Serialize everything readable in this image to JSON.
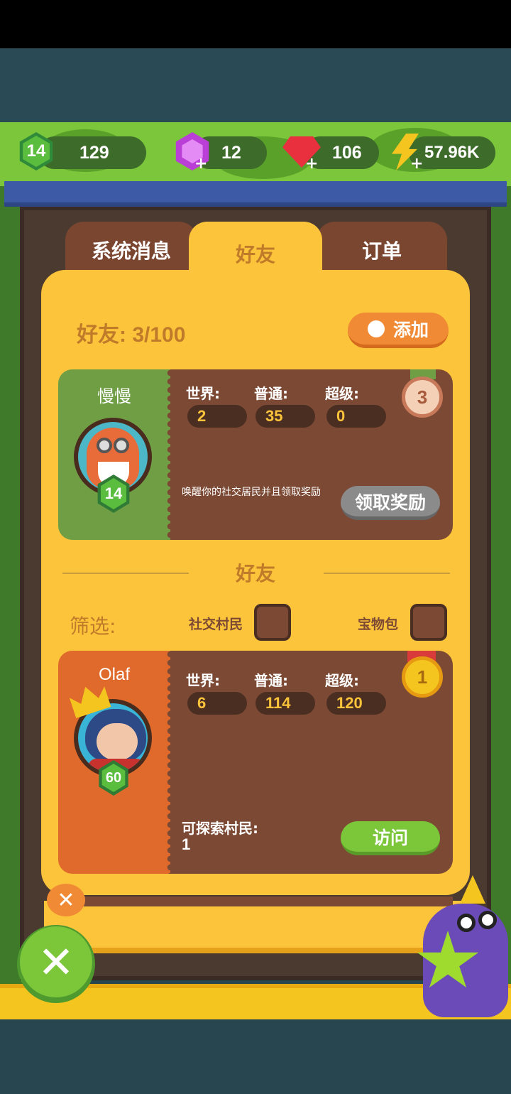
{
  "resources": {
    "level": "14",
    "xp": "129",
    "purple_gems": "12",
    "red_gems": "106",
    "energy": "57.96K"
  },
  "tabs": [
    {
      "label": "系统消息"
    },
    {
      "label": "好友"
    },
    {
      "label": "订单"
    }
  ],
  "friends_header": {
    "count_label": "好友: 3/100",
    "add_button": "添加"
  },
  "featured_friend": {
    "name": "慢慢",
    "level": "14",
    "stats": [
      {
        "label": "世界:",
        "value": "2"
      },
      {
        "label": "普通:",
        "value": "35"
      },
      {
        "label": "超级:",
        "value": "0"
      }
    ],
    "rank": "3",
    "message": "唤醒你的社交居民并且领取奖励",
    "action_button": "领取奖励"
  },
  "section_title": "好友",
  "filter": {
    "label": "筛选:",
    "option1": "社交村民",
    "option2": "宝物包"
  },
  "friend_list": [
    {
      "name": "Olaf",
      "level": "60",
      "stats": [
        {
          "label": "世界:",
          "value": "6"
        },
        {
          "label": "普通:",
          "value": "114"
        },
        {
          "label": "超级:",
          "value": "120"
        }
      ],
      "rank": "1",
      "explore_label": "可探索村民:",
      "explore_value": "1",
      "action_button": "访问"
    }
  ],
  "colors": {
    "panel": "#fcc43b",
    "card_brown": "#7c4a34",
    "featured_left": "#6f9e45",
    "list_left": "#e06a2b",
    "add_button": "#f08a34",
    "visit_button": "#7cc63a",
    "claim_button": "#8b8b8b"
  }
}
